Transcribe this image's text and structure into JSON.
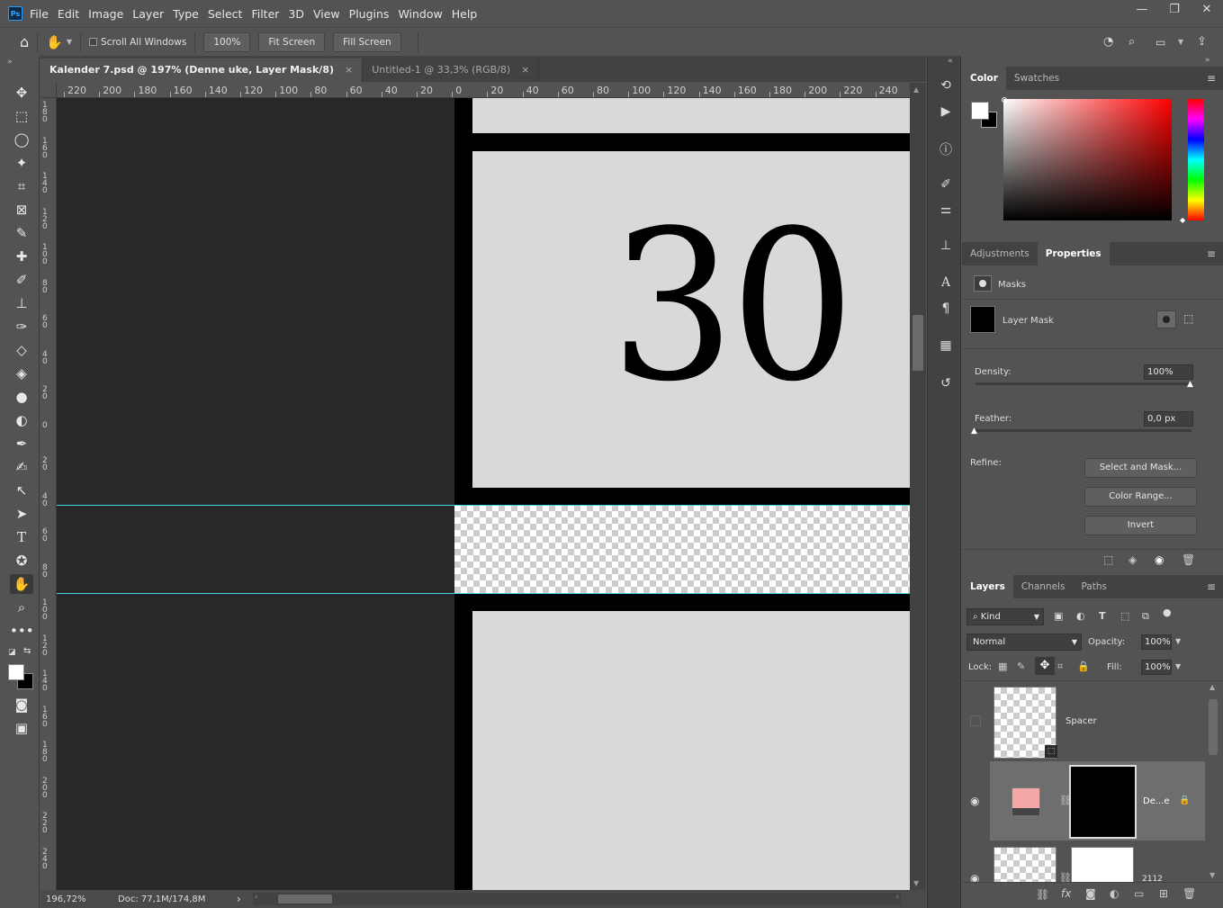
{
  "app": {
    "logo": "Ps"
  },
  "menu": [
    "File",
    "Edit",
    "Image",
    "Layer",
    "Type",
    "Select",
    "Filter",
    "3D",
    "View",
    "Plugins",
    "Window",
    "Help"
  ],
  "window_controls": {
    "minimize": "—",
    "restore": "❐",
    "close": "✕"
  },
  "options_bar": {
    "scroll_all_windows": "Scroll All Windows",
    "zoom_button": "100%",
    "fit_screen": "Fit Screen",
    "fill_screen": "Fill Screen"
  },
  "tabs": [
    {
      "label": "Kalender 7.psd @ 197% (Denne uke, Layer Mask/8)",
      "close": "×"
    },
    {
      "label": "Untitled-1 @ 33,3% (RGB/8)",
      "close": "×"
    }
  ],
  "ruler": {
    "h_ticks": [
      "220",
      "200",
      "180",
      "160",
      "140",
      "120",
      "100",
      "80",
      "60",
      "40",
      "20",
      "0",
      "20",
      "40",
      "60",
      "80",
      "100",
      "120",
      "140",
      "160",
      "180",
      "200",
      "220",
      "240"
    ],
    "v_ticks": [
      "180",
      "160",
      "140",
      "120",
      "100",
      "80",
      "60",
      "40",
      "20",
      "0",
      "20",
      "40",
      "60",
      "80",
      "100",
      "120",
      "140",
      "160",
      "180",
      "200",
      "220",
      "240"
    ]
  },
  "canvas": {
    "number_text": "30"
  },
  "status": {
    "zoom": "196,72%",
    "doc": "Doc: 77,1M/174,8M",
    "arrow": "›"
  },
  "color_panel": {
    "tabs": [
      "Color",
      "Swatches"
    ],
    "hue_color": "#ff0000",
    "foreground": "#ffffff",
    "background": "#000000"
  },
  "properties_panel": {
    "tabs": [
      "Adjustments",
      "Properties"
    ],
    "section": "Masks",
    "mask_label": "Layer Mask",
    "density_label": "Density:",
    "density_value": "100%",
    "density": 1.0,
    "feather_label": "Feather:",
    "feather_value": "0,0 px",
    "feather": 0.0,
    "refine_label": "Refine:",
    "select_and_mask": "Select and Mask...",
    "color_range": "Color Range...",
    "invert": "Invert"
  },
  "layers_panel": {
    "tabs": [
      "Layers",
      "Channels",
      "Paths"
    ],
    "filter_kind": "Kind",
    "blend_mode": "Normal",
    "opacity_label": "Opacity:",
    "opacity_value": "100%",
    "lock_label": "Lock:",
    "fill_label": "Fill:",
    "fill_value": "100%",
    "layers": [
      {
        "name": "Spacer"
      },
      {
        "name": "De...e",
        "swatch_color": "#f4a7a7"
      },
      {
        "name": "2112"
      }
    ]
  },
  "menu_icon": "≡"
}
